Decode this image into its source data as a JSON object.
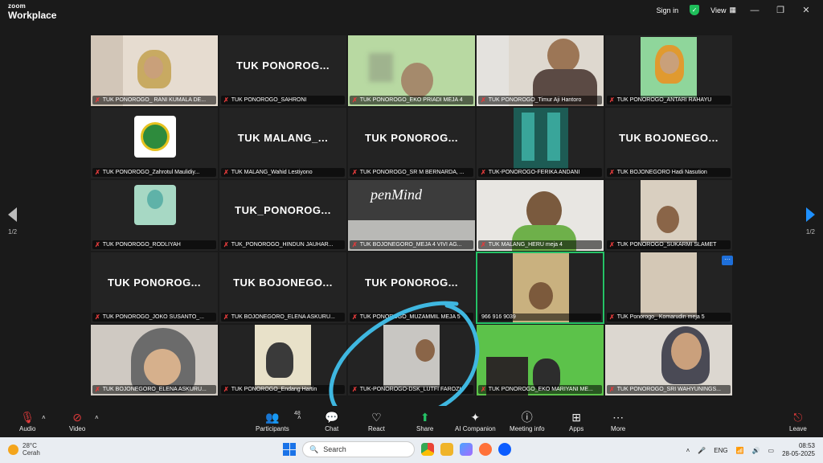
{
  "app": {
    "brand_small": "zoom",
    "brand": "Workplace"
  },
  "top_right": {
    "signin": "Sign in",
    "view": "View"
  },
  "pager": {
    "left": "1/2",
    "right": "1/2"
  },
  "tiles": [
    {
      "label": "TUK PONOROGO_ RANI KUMALA DE...",
      "type": "video"
    },
    {
      "label": "TUK PONOROGO_SAHRONI",
      "type": "name",
      "big": "TUK  PONOROG..."
    },
    {
      "label": "TUK PONOROGO_EKO PRIADI MEJA 4",
      "type": "video"
    },
    {
      "label": "TUK PONOROGO_Timur Aji Hantoro",
      "type": "video"
    },
    {
      "label": "TUK PONOROGO_ANTARI RAHAYU",
      "type": "video"
    },
    {
      "label": "TUK PONOROGO_Zahrotul Maulidiy...",
      "type": "video"
    },
    {
      "label": "TUK MALANG_Wahid Lestiyono",
      "type": "name",
      "big": "TUK  MALANG_..."
    },
    {
      "label": "TUK PONOROGO_SR M BERNARDA, ...",
      "type": "name",
      "big": "TUK  PONOROG..."
    },
    {
      "label": "TUK-PONOROGO-FERIKA ANDANI",
      "type": "video"
    },
    {
      "label": "TUK BOJONEGORO Hadi Nasution",
      "type": "name",
      "big": "TUK  BOJONEGO..."
    },
    {
      "label": "TUK PONOROGO_RODLIYAH",
      "type": "video"
    },
    {
      "label": "TUK_PONOROGO_HINDUN JAUHAR...",
      "type": "name",
      "big": "TUK_PONOROG..."
    },
    {
      "label": "TUK BOJONEGORO_MEJA 4 VIVI AG...",
      "type": "video",
      "text": "penMind"
    },
    {
      "label": "TUK MALANG_HERU meja 4",
      "type": "video"
    },
    {
      "label": "TUK PONOROGO_SUKARMI SLAMET",
      "type": "video"
    },
    {
      "label": "TUK PONOROGO_JOKO SUSANTO_...",
      "type": "name",
      "big": "TUK  PONOROG..."
    },
    {
      "label": "TUK BOJONEGORO_ELENA ASKURU...",
      "type": "name",
      "big": "TUK  BOJONEGO..."
    },
    {
      "label": "TUK PONOROGO_MUZAMMIL MEJA 5",
      "type": "name",
      "big": "TUK  PONOROG..."
    },
    {
      "label": "966 916 9039",
      "type": "video"
    },
    {
      "label": "TUK Ponorogo_ Komarudin meja 5",
      "type": "video"
    },
    {
      "label": "TUK BOJONEGORO_ELENA ASKURU...",
      "type": "video"
    },
    {
      "label": "TUK PONOROGO_Endang Hartin",
      "type": "video"
    },
    {
      "label": "TUK-PONOROGO-DSK_LUTFI FAROZI",
      "type": "video"
    },
    {
      "label": "TUK PONOROGO_EKO MARIYANI ME...",
      "type": "video"
    },
    {
      "label": "TUK PONOROGO_SRI WAHYUNINGS...",
      "type": "video"
    }
  ],
  "toolbar": {
    "audio": "Audio",
    "video": "Video",
    "participants": "Participants",
    "participants_count": "48",
    "chat": "Chat",
    "react": "React",
    "share": "Share",
    "ai": "AI Companion",
    "meeting_info": "Meeting info",
    "apps": "Apps",
    "more": "More",
    "leave": "Leave"
  },
  "taskbar": {
    "temp": "28°C",
    "weather": "Cerah",
    "search": "Search",
    "lang": "ENG",
    "time": "08:53",
    "date": "28-05-2025"
  },
  "colors": {
    "active_border": "#25c266",
    "annotation": "#3fb7e0",
    "muted": "#e23b3b"
  }
}
